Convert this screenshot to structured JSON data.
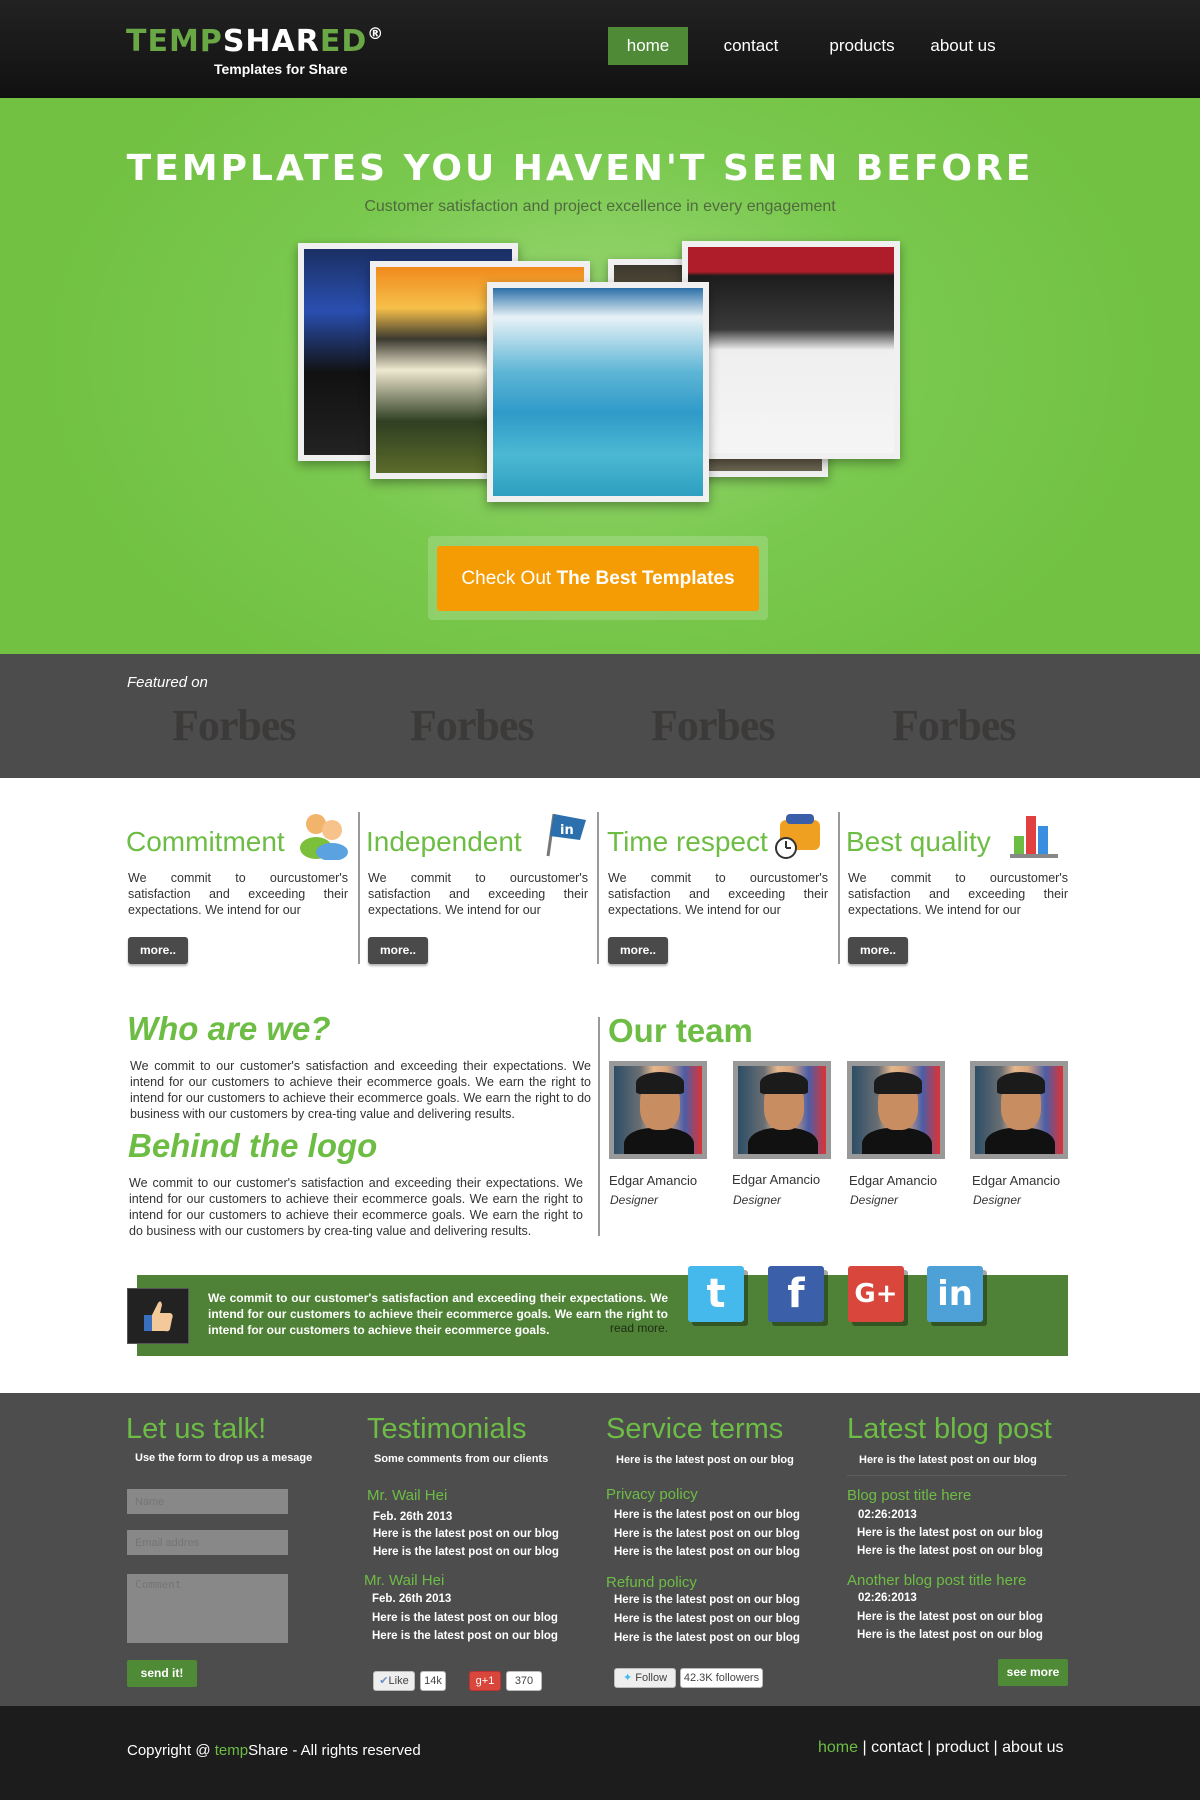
{
  "header": {
    "logo_part1": "TEMP",
    "logo_part2": "SHAR",
    "logo_part3": "ED",
    "logo_mark": "®",
    "tagline": "Templates for Share",
    "nav": [
      "home",
      "contact",
      "products",
      "about us"
    ]
  },
  "hero": {
    "title": "TEMPLATES YOU HAVEN'T  SEEN BEFORE",
    "subtitle": "Customer satisfaction and project excellence in every engagement",
    "cta_prefix": "Check Out ",
    "cta_bold": "The Best Templates"
  },
  "featured": {
    "label": "Featured on",
    "logos": [
      "Forbes",
      "Forbes",
      "Forbes",
      "Forbes"
    ]
  },
  "features": [
    {
      "title": "Commitment",
      "text": "We commit to ourcustomer's satisfaction and exceeding their expectations. We intend for our",
      "button": "more..",
      "icon": "users-icon"
    },
    {
      "title": "Independent",
      "text": "We commit to ourcustomer's satisfaction and exceeding their expectations. We intend for our",
      "button": "more..",
      "icon": "linkedin-flag-icon"
    },
    {
      "title": "Time respect",
      "text": "We commit to ourcustomer's satisfaction and exceeding their expectations. We intend for our",
      "button": "more..",
      "icon": "clock-bag-icon"
    },
    {
      "title": "Best quality",
      "text": "We commit to ourcustomer's satisfaction and exceeding their expectations. We intend for our",
      "button": "more..",
      "icon": "bar-chart-icon"
    }
  ],
  "about": {
    "who_title": "Who are we?",
    "who_text": "We commit to our customer's  satisfaction and exceeding  their   expectations.  We intend for our  customers to achieve their ecommerce  goals. We earn the right to intend for our customers to achieve their ecommerce   goals.  We  earn  the right to do business  with our customers by crea-ting value and delivering  results.",
    "logo_title": "Behind the logo",
    "logo_text": "We commit to our customer's satisfaction and exceeding their   expectations.  We intend for our customers to achieve their ecommerce  goals.  We  earn  the right to intend for our customers to achieve their ecommerce  goals.  We  earn  the right to do business  with our customers by crea-ting value and delivering results."
  },
  "team": {
    "title": "Our team",
    "members": [
      {
        "name": "Edgar Amancio",
        "role": "Designer"
      },
      {
        "name": "Edgar Amancio",
        "role": "Designer"
      },
      {
        "name": "Edgar Amancio",
        "role": "Designer"
      },
      {
        "name": "Edgar Amancio",
        "role": "Designer"
      }
    ]
  },
  "banner": {
    "text": "We commit to our customer's satisfaction and exceeding their   expectations.  We intend for our customers to achieve their ecommerce  goals.  We   earn the right  to intend for our customers to  achieve their ecommerce   goals.",
    "read_more": "read more.",
    "social": [
      {
        "icon": "twitter-icon",
        "glyph": "t",
        "color": "#45b8ec"
      },
      {
        "icon": "facebook-icon",
        "glyph": "f",
        "color": "#3b5fa8"
      },
      {
        "icon": "google-plus-icon",
        "glyph": "G+",
        "color": "#d9463b"
      },
      {
        "icon": "linkedin-icon",
        "glyph": "in",
        "color": "#4da1d6"
      }
    ]
  },
  "footer": {
    "talk_title": "Let us talk!",
    "talk_sub": "Use the form to drop us a mesage",
    "name_placeholder": "Name",
    "email_placeholder": "Email addres",
    "comment_placeholder": "Comment",
    "send_button": "send it!",
    "testimonials_title": "Testimonials",
    "testimonials_sub": "Some comments from our clients",
    "testimonials": [
      {
        "name": "Mr. Wail Hei",
        "date": "Feb. 26th 2013",
        "line1": "Here is the latest post on our blog",
        "line2": "Here is the latest post on our blog"
      },
      {
        "name": "Mr. Wail Hei",
        "date": "Feb. 26th 2013",
        "line1": "Here is the latest post on our blog",
        "line2": "Here is the latest post on our blog"
      }
    ],
    "like_label": "Like",
    "like_count": "14k",
    "plus_label": "+1",
    "plus_count": "370",
    "service_title": "Service terms",
    "service_sub": "Here is the latest post on our blog",
    "policies": [
      {
        "title": "Privacy policy",
        "lines": [
          "Here is the latest post on our blog",
          "Here is the latest post on our blog",
          "Here is the latest post on our blog"
        ]
      },
      {
        "title": "Refund policy",
        "lines": [
          "Here is the latest post on our blog",
          "Here is the latest post on our blog",
          "Here is the latest post on our blog"
        ]
      }
    ],
    "follow_label": "Follow",
    "followers": "42.3K followers",
    "blog_title": "Latest  blog post",
    "blog_sub": "Here is the latest post on our blog",
    "posts": [
      {
        "title": "Blog post title here",
        "date": "02:26:2013",
        "line1": "Here is the latest post on our blog",
        "line2": "Here is the latest post on our blog"
      },
      {
        "title": "Another blog post title here",
        "date": "02:26:2013",
        "line1": "Here is the latest post on our blog",
        "line2": "Here is the latest post on our blog"
      }
    ],
    "see_more": "see more"
  },
  "bottom": {
    "copyright_prefix": "Copyright @ ",
    "copyright_brand": "temp",
    "copyright_suffix": "Share - All rights reserved",
    "links": [
      "home",
      "contact",
      "product",
      "about us"
    ],
    "separator": " | "
  },
  "colors": {
    "green": "#6dbd45",
    "dark_green": "#4f8a37",
    "orange": "#f59c05",
    "footer_gray": "#4d4d4d"
  }
}
